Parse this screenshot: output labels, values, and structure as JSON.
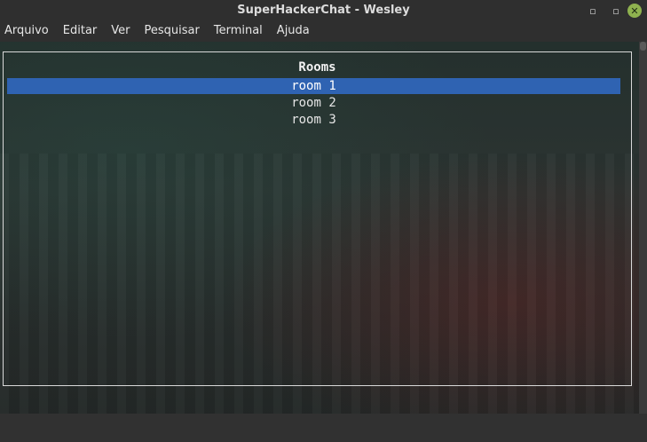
{
  "window": {
    "title": "SuperHackerChat - Wesley",
    "buttons": {
      "minimize": "▫",
      "maximize": "▫",
      "close": "✕"
    }
  },
  "menu": {
    "items": [
      "Arquivo",
      "Editar",
      "Ver",
      "Pesquisar",
      "Terminal",
      "Ajuda"
    ]
  },
  "rooms": {
    "title": "Rooms",
    "items": [
      "room 1",
      "room 2",
      "room 3"
    ],
    "selected_index": 0
  },
  "colors": {
    "selection": "#2f63b2",
    "close_button": "#8fb24f"
  }
}
